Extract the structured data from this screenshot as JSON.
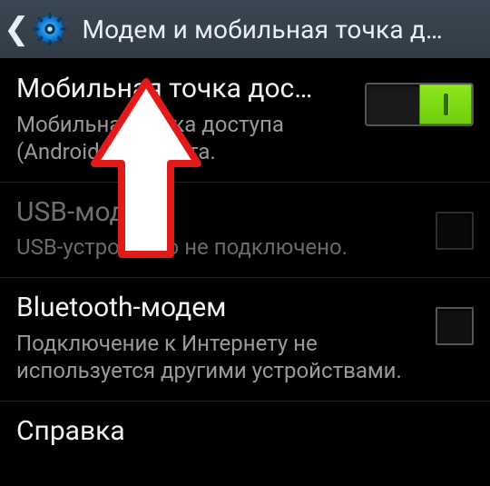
{
  "header": {
    "title": "Модем и мобильная точка д…"
  },
  "rows": {
    "hotspot": {
      "title": "Мобильная точка дос…",
      "subtitle": "Мобильная точка доступа (AndroidAP) занята.",
      "toggle_on": true
    },
    "usb": {
      "title": "USB-модем",
      "subtitle": "USB-устройство не подключено.",
      "checked": false,
      "enabled": false
    },
    "bt": {
      "title": "Bluetooth-модем",
      "subtitle": "Подключение к Интернету не используется другими устройствами.",
      "checked": false,
      "enabled": true
    },
    "help": {
      "title": "Справка"
    }
  }
}
